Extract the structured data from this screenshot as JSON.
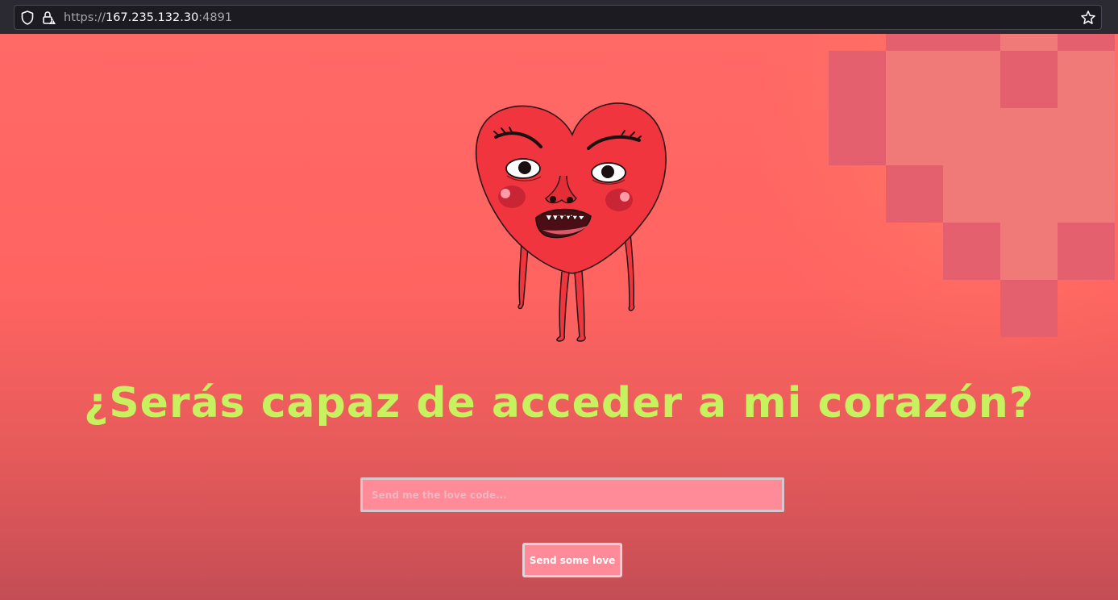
{
  "browser": {
    "url_scheme": "https://",
    "url_host": "167.235.132.30",
    "url_port": ":4891",
    "icons": [
      "shield-icon",
      "lock-warning-icon",
      "star-icon"
    ]
  },
  "page": {
    "headline": "¿Serás capaz de acceder a mi corazón?",
    "input": {
      "placeholder": "Send me the love code...",
      "value": ""
    },
    "button_label": "Send some love",
    "colors": {
      "background_top": "#ff6966",
      "background_bottom": "#c44d55",
      "headline": "#c7f15e",
      "input_bg": "#ff8a98",
      "pixel_dark": "#e5606f",
      "pixel_light": "#ef7a78",
      "heart_red": "#f0353e"
    }
  }
}
